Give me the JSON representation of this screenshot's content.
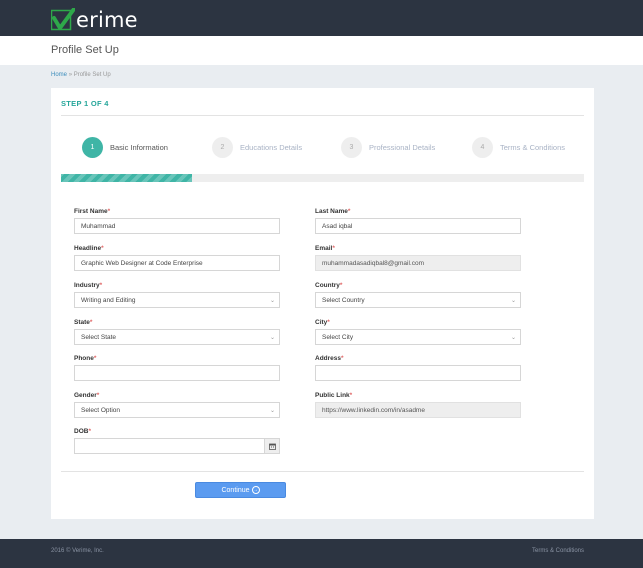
{
  "header": {
    "logo_text": "erime",
    "page_title": "Profile Set Up"
  },
  "breadcrumb": {
    "home": "Home",
    "separator": "»",
    "current": "Profile Set Up"
  },
  "step_heading": "STEP 1 OF 4",
  "wizard": {
    "steps": [
      {
        "number": "1",
        "label": "Basic Information",
        "active": true
      },
      {
        "number": "2",
        "label": "Educations Details",
        "active": false
      },
      {
        "number": "3",
        "label": "Professional Details",
        "active": false
      },
      {
        "number": "4",
        "label": "Terms & Conditions",
        "active": false
      }
    ],
    "progress_fraction": 0.25
  },
  "form": {
    "first_name": {
      "label": "First Name",
      "value": "Muhammad"
    },
    "last_name": {
      "label": "Last Name",
      "value": "Asad iqbal"
    },
    "headline": {
      "label": "Headline",
      "value": "Graphic Web Designer at Code Enterprise"
    },
    "email": {
      "label": "Email",
      "value": "muhammadasadiqbal8@gmail.com"
    },
    "industry": {
      "label": "Industry",
      "value": "Writing and Editing"
    },
    "country": {
      "label": "Country",
      "value": "Select Country"
    },
    "state": {
      "label": "State",
      "value": "Select State"
    },
    "city": {
      "label": "City",
      "value": "Select City"
    },
    "phone": {
      "label": "Phone",
      "value": ""
    },
    "address": {
      "label": "Address",
      "value": ""
    },
    "gender": {
      "label": "Gender",
      "value": "Select Option"
    },
    "public_link": {
      "label": "Public Link",
      "value": "https://www.linkedin.com/in/asadme"
    },
    "dob": {
      "label": "DOB",
      "value": ""
    },
    "required_marker": "*"
  },
  "continue_label": "Continue",
  "footer": {
    "copyright": "2016 © Verime, Inc.",
    "terms_link": "Terms & Conditions"
  },
  "colors": {
    "accent": "#3fb5a6",
    "brand_green": "#2ea84a",
    "header_bg": "#2c3441",
    "button": "#5b9bf0"
  },
  "icons": {
    "logo": "checkmark-v-logo-icon",
    "select": "chevron-down-icon",
    "date": "calendar-icon",
    "continue": "circle-arrow-right-icon"
  }
}
